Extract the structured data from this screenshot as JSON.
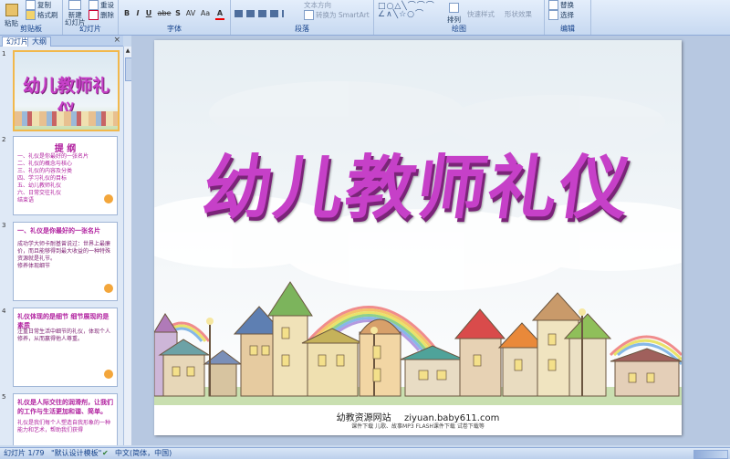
{
  "ribbon": {
    "clipboard": {
      "label": "剪贴板",
      "paste": "粘贴",
      "copy": "复制",
      "format_painter": "格式刷"
    },
    "slides": {
      "label": "幻灯片",
      "new_slide": "新建\n幻灯片",
      "reset": "重设",
      "delete": "删除"
    },
    "font": {
      "label": "字体",
      "bold": "B",
      "italic": "I",
      "underline": "U",
      "strike": "abe",
      "shadow": "S",
      "spacing": "AV",
      "case": "Aa",
      "color": "A"
    },
    "paragraph": {
      "label": "段落",
      "convert_smartart": "转换为 SmartArt",
      "text_align": "文本方向"
    },
    "drawing": {
      "label": "绘图",
      "arrange": "排列",
      "quick_styles": "快速样式",
      "shape_effects": "形状效果"
    },
    "editing": {
      "label": "编辑",
      "replace": "替换",
      "select": "选择"
    }
  },
  "panel_tabs": {
    "slides": "幻灯片",
    "outline": "大纲",
    "close": "×"
  },
  "thumbnails": [
    {
      "num": "1",
      "title": "幼儿教师礼仪"
    },
    {
      "num": "2",
      "title": "提  纲",
      "lines": [
        "一、礼仪是你最好的一张名片",
        "二、礼仪的概念与核心",
        "三、礼仪的内容及分类",
        "四、学习礼仪的目标",
        "五、幼儿教师礼仪",
        "六、日常交往礼仪",
        "结束语"
      ]
    },
    {
      "num": "3",
      "title": "一、礼仪是你最好的一张名片",
      "lines": [
        "成功学大师卡耐基曾说过：世界上最廉价，而且能够得到最大收益的一种特殊资源就是礼节。",
        "修养体现细节"
      ]
    },
    {
      "num": "4",
      "title": "礼仪体现的是细节 细节展现的是素质",
      "lines": [
        "注重日常生活中细节的礼仪，体现个人修养，从而赢得他人尊重。"
      ]
    },
    {
      "num": "5",
      "title": "礼仪是人际交往的润滑剂，让我们的工作与生活更加和谐、简单。",
      "lines": [
        "礼仪是我们每个人塑造自我形象的一种能力和艺术，帮助我们获得"
      ]
    }
  ],
  "slide": {
    "title": "幼儿教师礼仪",
    "site_name": "幼教资源网站",
    "site_url": "ziyuan.baby611.com",
    "site_sub": "课件下载    儿歌、故事MP3    FLASH课件下载    试卷下载等"
  },
  "status": {
    "slide_pos": "幻灯片 1/79",
    "theme": "\"默认设计模板\"",
    "language": "中文(简体，中国)"
  },
  "colors": {
    "title": "#c640c8",
    "ribbon": "#c7d9f1",
    "sky": "#cfe1ee"
  }
}
